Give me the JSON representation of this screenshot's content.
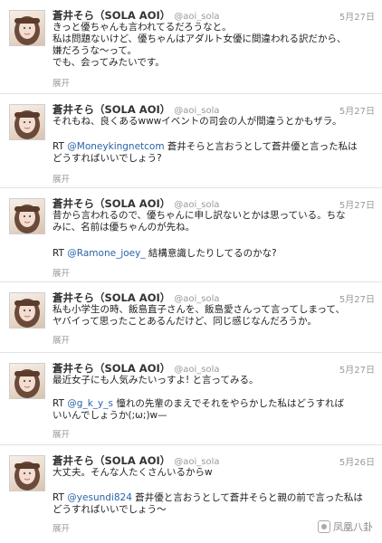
{
  "tweets": [
    {
      "name": "蒼井そら（SOLA AOI）",
      "handle": "@aoi_sola",
      "date": "5月27日",
      "lines": [
        "きっと優ちゃんも言われてるだろうなと。",
        "私は問題ないけど、優ちゃんはアダルト女優に間違われる訳だから、",
        "嫌だろうな〜って。",
        "でも、会ってみたいです。"
      ],
      "expand": "展开"
    },
    {
      "name": "蒼井そら（SOLA AOI）",
      "handle": "@aoi_sola",
      "date": "5月27日",
      "lines": [
        "それもね、良くあるwwwイベントの司会の人が間違うとかもザラ。"
      ],
      "rt_prefix": "RT ",
      "rt_mention": "@Moneykingnetcom",
      "rt_lines": [
        " 蒼井そらと言おうとして蒼井優と言った私は",
        "どうすればいいでしょう?"
      ],
      "expand": "展开"
    },
    {
      "name": "蒼井そら（SOLA AOI）",
      "handle": "@aoi_sola",
      "date": "5月27日",
      "lines": [
        "昔から言われるので、優ちゃんに申し訳ないとかは思っている。ちな",
        "みに、名前は優ちゃんのが先ね。"
      ],
      "rt_prefix": "RT ",
      "rt_mention": "@Ramone_joey_",
      "rt_lines": [
        " 結構意識したりしてるのかな?"
      ],
      "expand": "展开"
    },
    {
      "name": "蒼井そら（SOLA AOI）",
      "handle": "@aoi_sola",
      "date": "5月27日",
      "lines": [
        "私も小学生の時、飯島直子さんを、飯島愛さんって言ってしまって、",
        "ヤバイって思ったことあるんだけど、同じ感じなんだろうか。"
      ],
      "expand": "展开"
    },
    {
      "name": "蒼井そら（SOLA AOI）",
      "handle": "@aoi_sola",
      "date": "5月27日",
      "lines": [
        "最近女子にも人気みたいっすよ! と言ってみる。"
      ],
      "rt_prefix": "RT ",
      "rt_mention": "@g_k_y_s",
      "rt_lines": [
        " 憧れの先輩のまえでそれをやらかした私はどうすれば",
        "いいんでしょうか(;ω;)w—"
      ],
      "expand": "展开"
    },
    {
      "name": "蒼井そら（SOLA AOI）",
      "handle": "@aoi_sola",
      "date": "5月26日",
      "lines": [
        "大丈夫。そんな人たくさんいるからw"
      ],
      "rt_prefix": "RT ",
      "rt_mention": "@yesundi824",
      "rt_lines": [
        " 蒼井優と言おうとして蒼井そらと親の前で言った私は",
        "どうすればいいでしょう〜"
      ],
      "expand": "展开"
    }
  ],
  "watermark": {
    "text": "凤凰八卦"
  },
  "colors": {
    "mention": "#2a63a6",
    "meta": "#999999",
    "divider": "#e2e2e2"
  }
}
